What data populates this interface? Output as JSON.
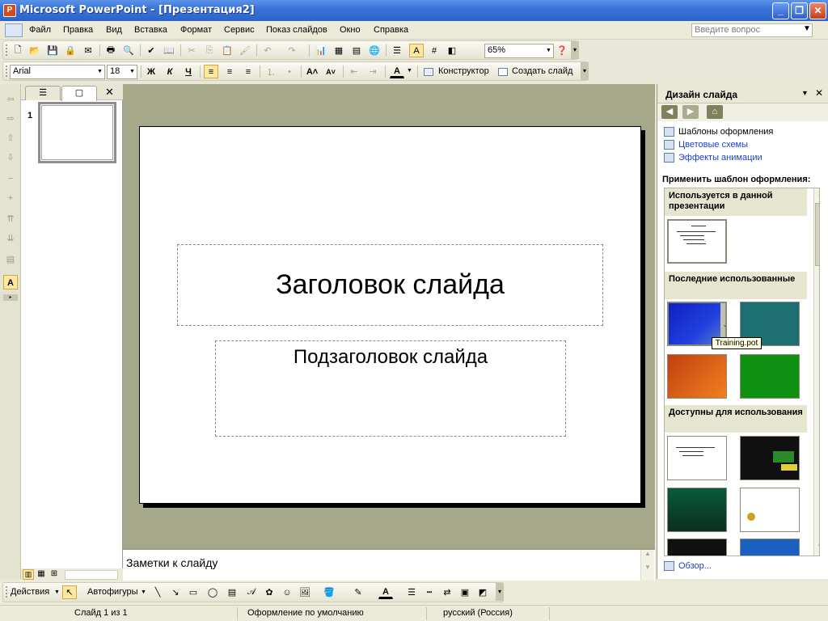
{
  "window": {
    "title": "Microsoft PowerPoint - [Презентация2]",
    "app_icon": "P"
  },
  "menu": {
    "items": [
      "Файл",
      "Правка",
      "Вид",
      "Вставка",
      "Формат",
      "Сервис",
      "Показ слайдов",
      "Окно",
      "Справка"
    ],
    "help_placeholder": "Введите вопрос"
  },
  "standard_toolbar": {
    "zoom": "65%"
  },
  "formatting_toolbar": {
    "font": "Arial",
    "size": "18",
    "bold": "Ж",
    "italic": "К",
    "underline": "Ч",
    "designer": "Конструктор",
    "new_slide": "Создать слайд"
  },
  "outline_pane": {
    "slide_number": "1"
  },
  "slide": {
    "title": "Заголовок слайда",
    "subtitle": "Подзаголовок слайда"
  },
  "notes": {
    "placeholder": "Заметки к слайду"
  },
  "task_pane": {
    "title": "Дизайн слайда",
    "links": [
      "Шаблоны оформления",
      "Цветовые схемы",
      "Эффекты анимации"
    ],
    "apply_label": "Применить шаблон оформления:",
    "section_used": "Используется в данной презентации",
    "section_recent": "Последние использованные",
    "section_available": "Доступны для использования",
    "tooltip": "Training.pot",
    "browse": "Обзор..."
  },
  "drawing_toolbar": {
    "actions": "Действия",
    "autoshapes": "Автофигуры"
  },
  "status": {
    "slide": "Слайд 1 из 1",
    "design": "Оформление по умолчанию",
    "language": "русский (Россия)"
  },
  "colors": {
    "titlebar": "#3a74d8",
    "workspace": "#a5a98a",
    "accent": "#fbe8a2"
  }
}
